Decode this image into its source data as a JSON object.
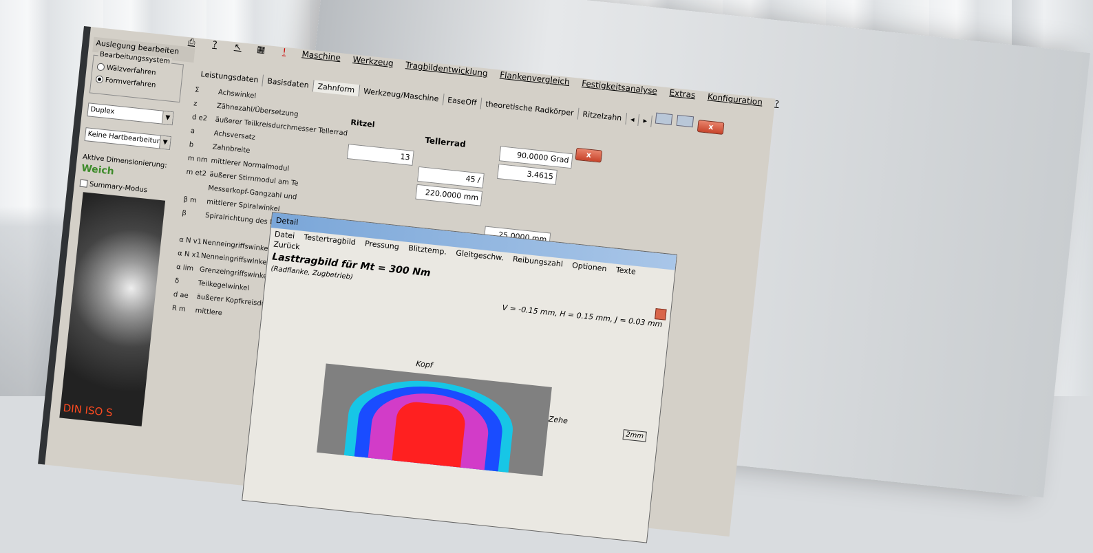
{
  "menu": [
    "Maschine",
    "Werkzeug",
    "Tragbildentwicklung",
    "Flankenvergleich",
    "Festigkeitsanalyse",
    "Extras",
    "Konfiguration",
    "?"
  ],
  "toolbar": {
    "icons": [
      "print-icon",
      "question-icon",
      "help-cursor-icon",
      "table-icon",
      "warning-icon"
    ]
  },
  "left_panel": {
    "title": "Auslegung bearbeiten",
    "bearbeitung_legend": "Bearbeitungssystem",
    "radio_1": "Wälzverfahren",
    "radio_2": "Formverfahren",
    "combo_1": "Duplex",
    "combo_2": "Keine Hartbearbeitung",
    "dimension_label": "Aktive Dimensionierung:",
    "dimension_value": "Weich",
    "summary_label": "Summary-Modus",
    "image_caption": "DIN ISO S"
  },
  "tabs": [
    "Leistungsdaten",
    "Basisdaten",
    "Zahnform",
    "Werkzeug/Maschine",
    "EaseOff",
    "theoretische Radkörper",
    "Ritzelzahn"
  ],
  "columns": {
    "ritzel": "Ritzel",
    "tellerrad": "Tellerrad"
  },
  "rows": [
    {
      "sym": "Σ",
      "label": "Achswinkel"
    },
    {
      "sym": "z",
      "label": "Zähnezahl/Übersetzung"
    },
    {
      "sym": "d e2",
      "label": "äußerer Teilkreisdurchmesser Tellerrad"
    },
    {
      "sym": "a",
      "label": "Achsversatz"
    },
    {
      "sym": "b",
      "label": "Zahnbreite"
    },
    {
      "sym": "m nm",
      "label": "mittlerer Normalmodul"
    },
    {
      "sym": "m et2",
      "label": "äußerer Stirnmodul am Te"
    },
    {
      "sym": "",
      "label": "Messerkopf-Gangzahl und"
    },
    {
      "sym": "β m",
      "label": "mittlerer Spiralwinkel"
    },
    {
      "sym": "β",
      "label": "Spiralrichtung des Ritzels"
    },
    {
      "sym": "α N v1",
      "label": "Nenneingriffswinkel Zug"
    },
    {
      "sym": "α N x1",
      "label": "Nenneingriffswinkel Schu"
    },
    {
      "sym": "α lim",
      "label": "Grenzeingriffswinkel"
    },
    {
      "sym": "δ",
      "label": "Teilkegelwinkel"
    },
    {
      "sym": "d ae",
      "label": "äußerer Kopfkreisdurch"
    },
    {
      "sym": "R m",
      "label": "mittlere"
    }
  ],
  "values": {
    "ritzel_z": "13",
    "teller_z": "45",
    "teller_z_sep": "/",
    "achswinkel": "90.0000",
    "achswinkel_unit": "Grad",
    "ratio": "3.4615",
    "d_e2": "220.0000",
    "d_e2_unit": "mm",
    "b": "25.0000",
    "b_unit": "mm"
  },
  "close_label": "x",
  "detail": {
    "title": "Detail",
    "menu": [
      "Datei",
      "Testertragbild",
      "Pressung",
      "Blitztemp.",
      "Gleitgeschw.",
      "Reibungszahl",
      "Optionen",
      "Texte"
    ],
    "menu_back": "Zurück",
    "heading": "Lasttragbild für Mt = 300 Nm",
    "subheading": "(Radflanke, Zugbetrieb)",
    "params": "V = -0.15 mm,  H = 0.15 mm,  J = 0.03 mm",
    "kopf": "Kopf",
    "zehe": "Zehe",
    "scale": "2mm"
  },
  "colors": {
    "accent_green": "#3d8b2a",
    "heat_red": "#ff2020",
    "heat_magenta": "#d23cc8",
    "heat_blue": "#1a4cff",
    "heat_cyan": "#17c6e6"
  }
}
